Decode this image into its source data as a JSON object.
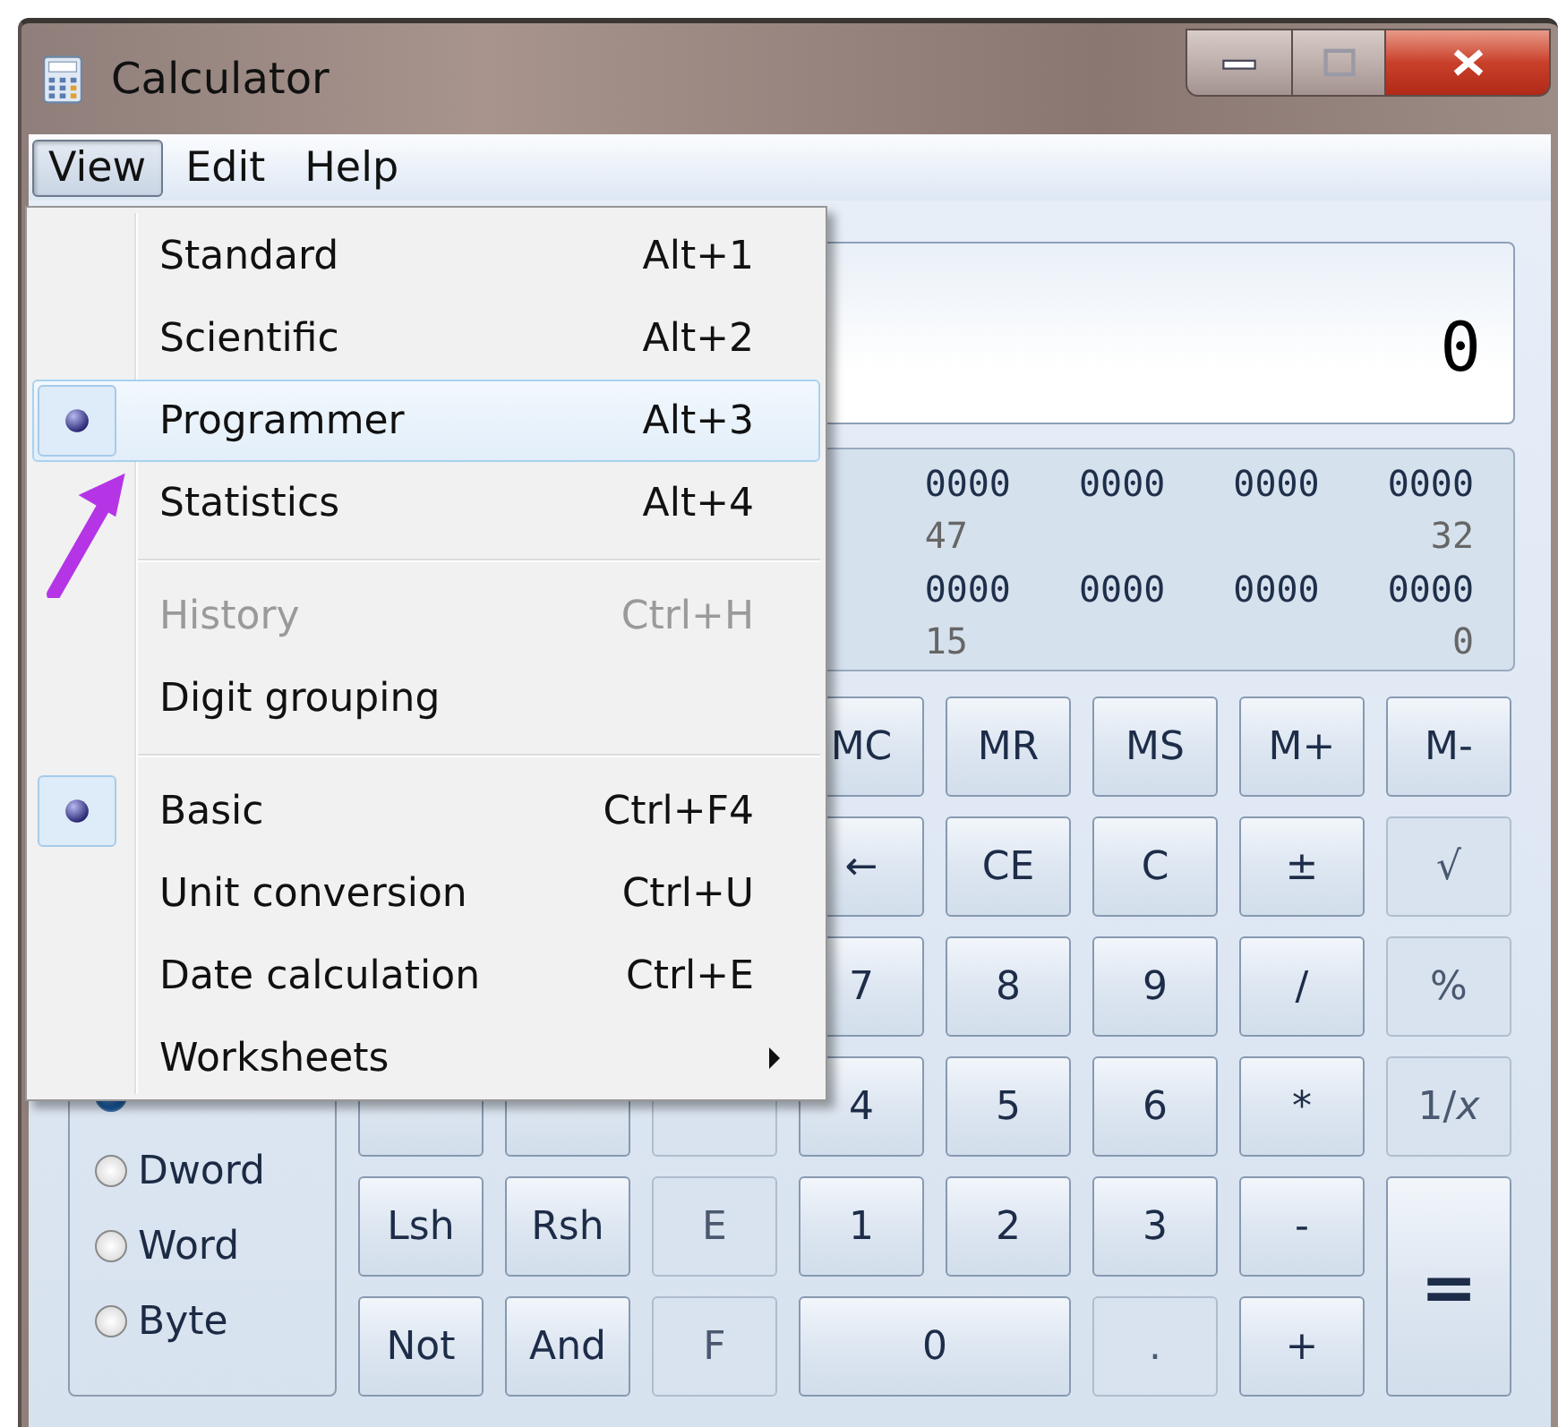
{
  "window": {
    "title": "Calculator"
  },
  "menu_bar": [
    {
      "label": "View",
      "selected": true
    },
    {
      "label": "Edit",
      "selected": false
    },
    {
      "label": "Help",
      "selected": false
    }
  ],
  "view_menu": [
    {
      "kind": "item",
      "label": "Standard",
      "shortcut": "Alt+1",
      "checked": false,
      "highlighted": false,
      "disabled": false
    },
    {
      "kind": "item",
      "label": "Scientific",
      "shortcut": "Alt+2",
      "checked": false,
      "highlighted": false,
      "disabled": false
    },
    {
      "kind": "item",
      "label": "Programmer",
      "shortcut": "Alt+3",
      "checked": true,
      "highlighted": true,
      "disabled": false
    },
    {
      "kind": "item",
      "label": "Statistics",
      "shortcut": "Alt+4",
      "checked": false,
      "highlighted": false,
      "disabled": false
    },
    {
      "kind": "separator"
    },
    {
      "kind": "item",
      "label": "History",
      "shortcut": "Ctrl+H",
      "checked": false,
      "highlighted": false,
      "disabled": true
    },
    {
      "kind": "item",
      "label": "Digit grouping",
      "checked": false,
      "highlighted": false,
      "disabled": false
    },
    {
      "kind": "separator"
    },
    {
      "kind": "item",
      "label": "Basic",
      "shortcut": "Ctrl+F4",
      "checked": true,
      "highlighted": false,
      "disabled": false
    },
    {
      "kind": "item",
      "label": "Unit conversion",
      "shortcut": "Ctrl+U",
      "checked": false,
      "highlighted": false,
      "disabled": false
    },
    {
      "kind": "item",
      "label": "Date calculation",
      "shortcut": "Ctrl+E",
      "checked": false,
      "highlighted": false,
      "disabled": false
    },
    {
      "kind": "submenu",
      "label": "Worksheets",
      "checked": false,
      "highlighted": false,
      "disabled": false
    }
  ],
  "display": {
    "value": "0"
  },
  "bit_panel": [
    {
      "groups": [
        "0000",
        "0000",
        "0000",
        "0000"
      ],
      "high_index": "47",
      "low_index": "32"
    },
    {
      "groups": [
        "0000",
        "0000",
        "0000",
        "0000"
      ],
      "high_index": "15",
      "low_index": "0"
    }
  ],
  "word_size": [
    {
      "selected": true
    },
    {
      "label": "Dword",
      "selected": false
    },
    {
      "label": "Word",
      "selected": false
    },
    {
      "label": "Byte",
      "selected": false
    }
  ],
  "keypad": [
    [
      {
        "kind": "key",
        "label": "MC",
        "disabled": false
      },
      {
        "kind": "key",
        "label": "MR",
        "disabled": false
      },
      {
        "kind": "key",
        "label": "MS",
        "disabled": false
      },
      {
        "kind": "key",
        "label": "M+",
        "disabled": false
      },
      {
        "kind": "key",
        "label": "M-",
        "disabled": false
      }
    ],
    [
      {
        "kind": "key",
        "label": "←",
        "disabled": false
      },
      {
        "kind": "key",
        "label": "CE",
        "disabled": false
      },
      {
        "kind": "key",
        "label": "C",
        "disabled": false
      },
      {
        "kind": "key",
        "label": "±",
        "disabled": false
      },
      {
        "kind": "key",
        "label": "√",
        "disabled": true
      }
    ],
    [
      {
        "kind": "key",
        "label": "7",
        "disabled": false
      },
      {
        "kind": "key",
        "label": "8",
        "disabled": false
      },
      {
        "kind": "key",
        "label": "9",
        "disabled": false
      },
      {
        "kind": "key",
        "label": "/",
        "disabled": false
      },
      {
        "kind": "key",
        "label": "%",
        "disabled": true
      }
    ],
    [
      {
        "kind": "covered",
        "disabled": false
      },
      {
        "kind": "covered",
        "disabled": false
      },
      {
        "kind": "covered",
        "disabled": true
      },
      {
        "kind": "key",
        "label": "4",
        "disabled": false
      },
      {
        "kind": "key",
        "label": "5",
        "disabled": false
      },
      {
        "kind": "key",
        "label": "6",
        "disabled": false
      },
      {
        "kind": "key",
        "label": "*",
        "disabled": false
      },
      {
        "kind": "key",
        "label": "1/*x*",
        "disabled": true
      }
    ],
    [
      {
        "kind": "key",
        "label": "Lsh",
        "disabled": false
      },
      {
        "kind": "key",
        "label": "Rsh",
        "disabled": false
      },
      {
        "kind": "key",
        "label": "E",
        "disabled": true
      },
      {
        "kind": "key",
        "label": "1",
        "disabled": false
      },
      {
        "kind": "key",
        "label": "2",
        "disabled": false
      },
      {
        "kind": "key",
        "label": "3",
        "disabled": false
      },
      {
        "kind": "key",
        "label": "-",
        "disabled": false
      },
      {
        "kind": "tall",
        "label": "=",
        "disabled": false
      }
    ],
    [
      {
        "kind": "key",
        "label": "Not",
        "disabled": false
      },
      {
        "kind": "key",
        "label": "And",
        "disabled": false
      },
      {
        "kind": "key",
        "label": "F",
        "disabled": true
      },
      {
        "kind": "wide",
        "label": "0",
        "disabled": false
      },
      {
        "kind": "key",
        "label": ".",
        "disabled": true
      },
      {
        "kind": "key",
        "label": "+",
        "disabled": false
      }
    ]
  ]
}
